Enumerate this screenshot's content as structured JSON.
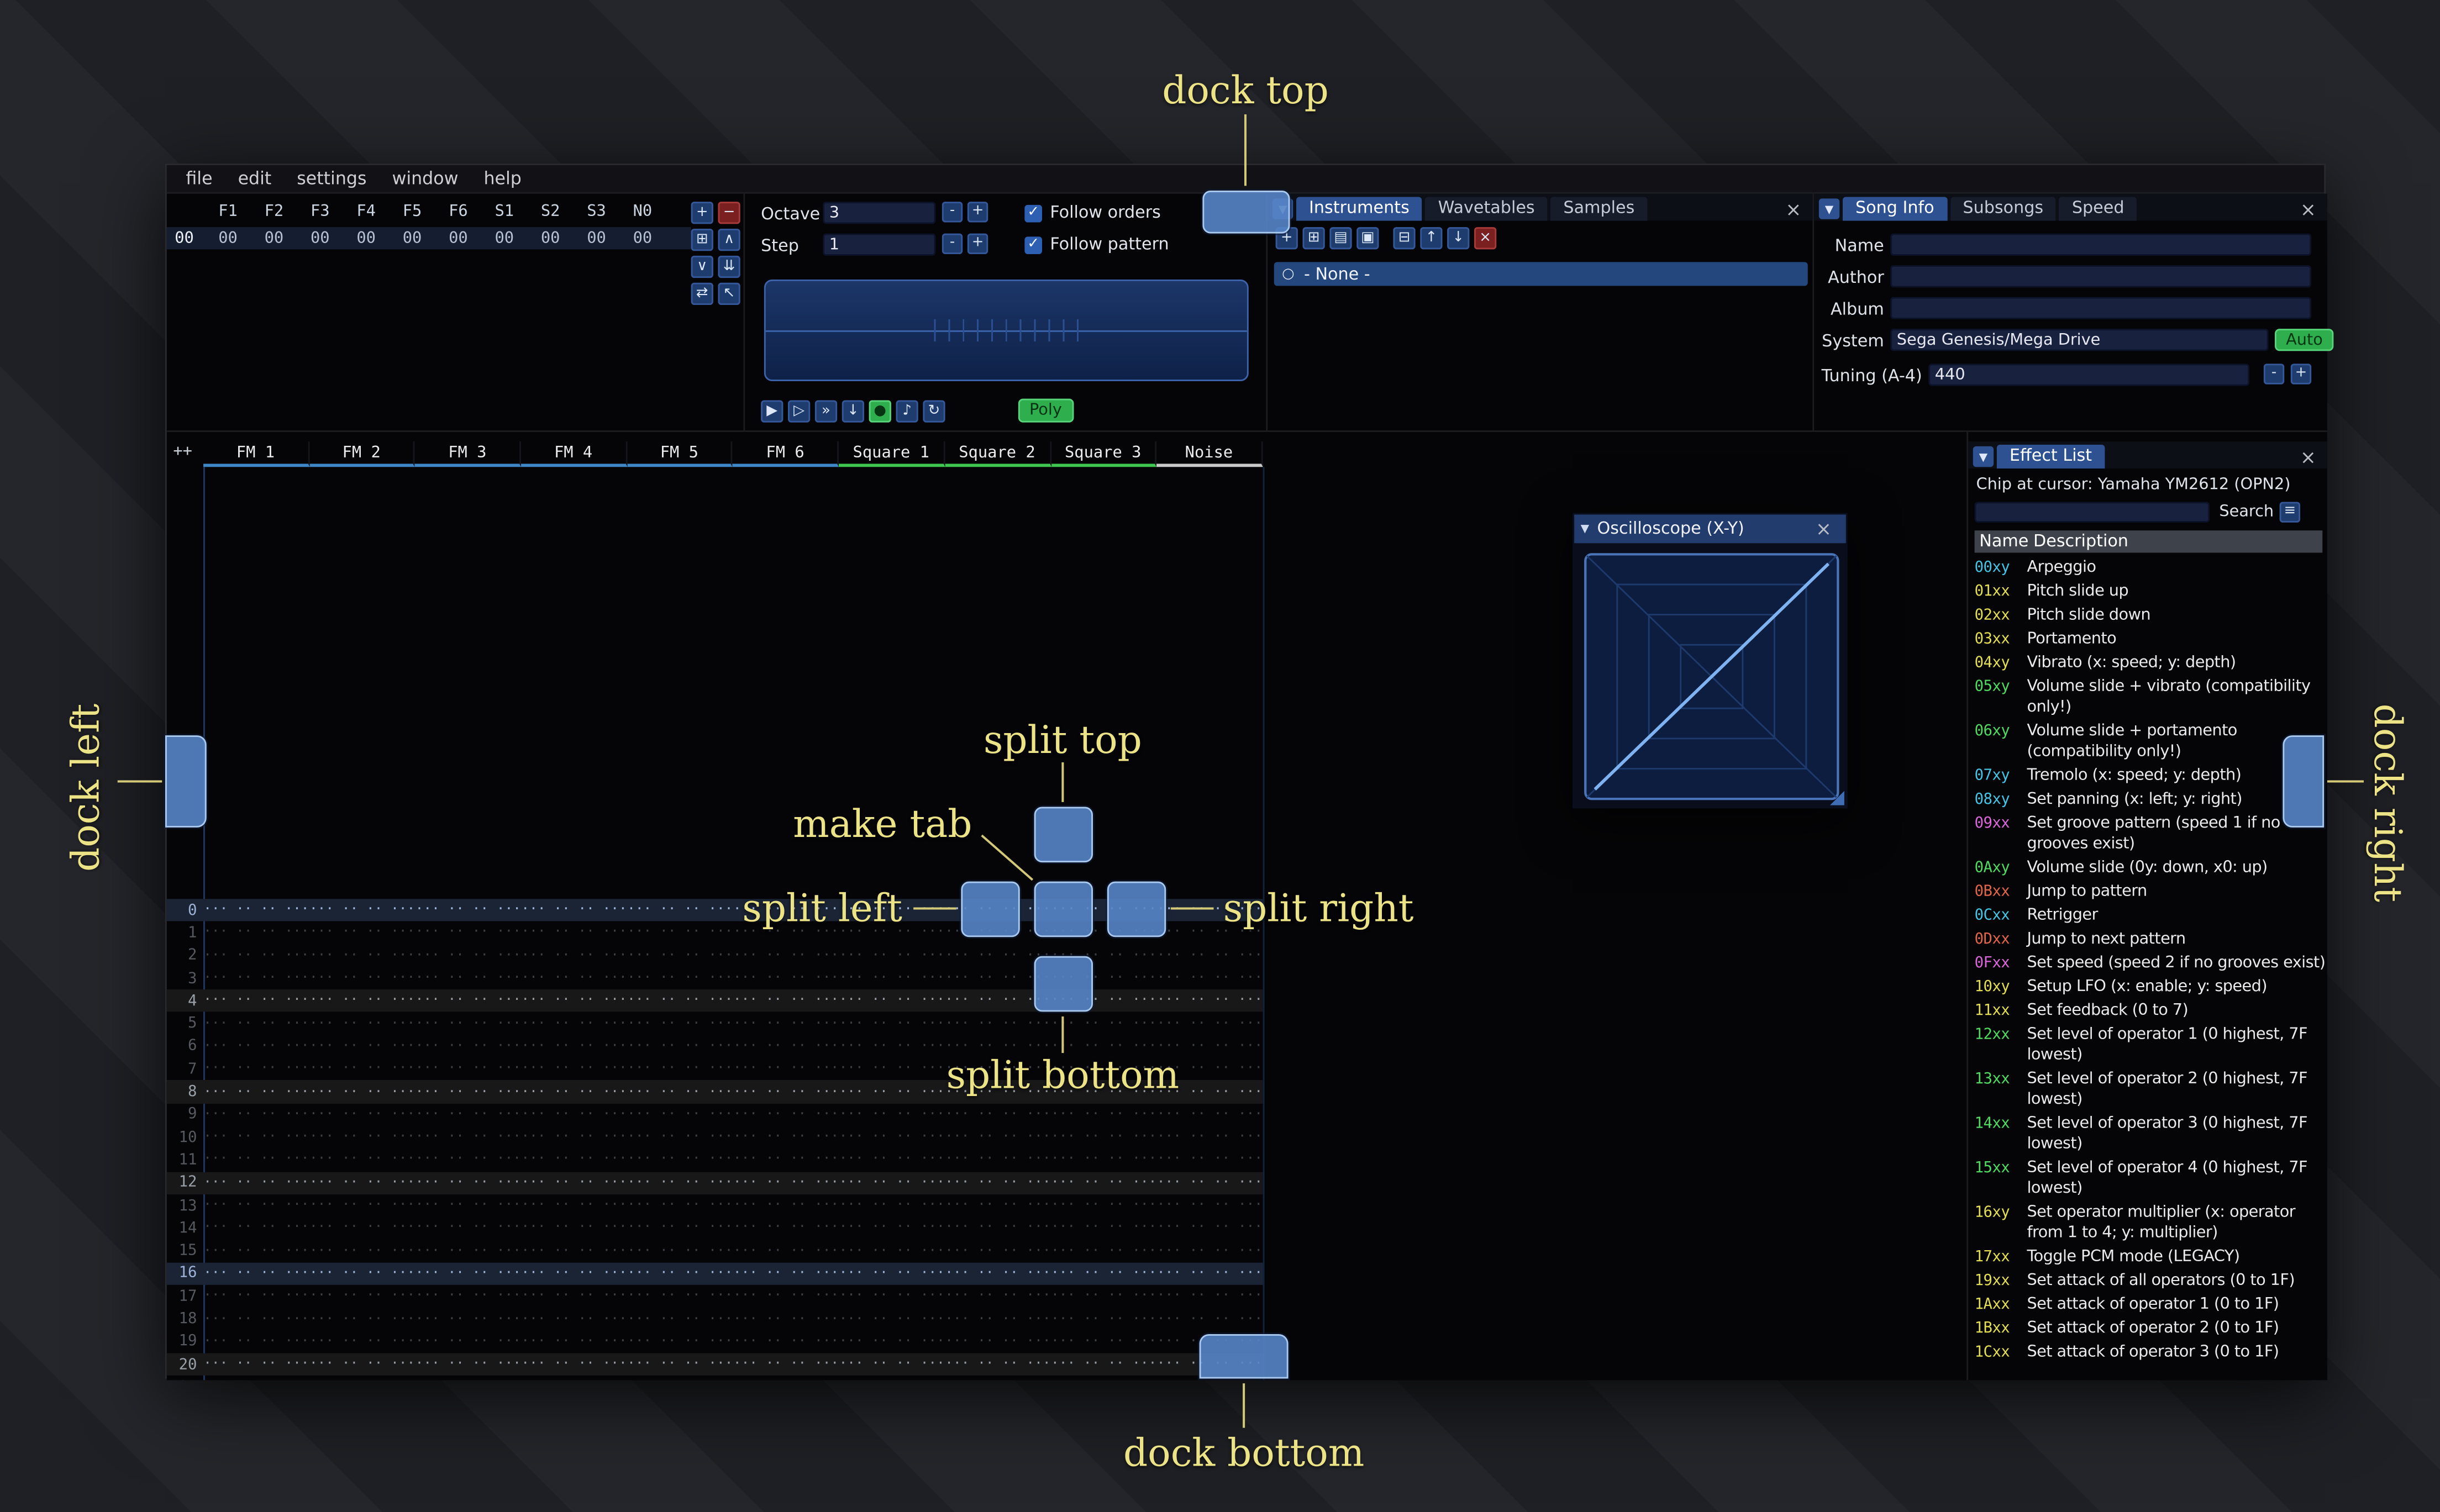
{
  "annotations": {
    "color": "#ece387",
    "dock_top": "dock top",
    "dock_bottom": "dock bottom",
    "dock_left": "dock left",
    "dock_right": "dock right",
    "split_top": "split top",
    "split_bottom": "split bottom",
    "split_left": "split left",
    "split_right": "split right",
    "make_tab": "make tab"
  },
  "menu": {
    "items": [
      "file",
      "edit",
      "settings",
      "window",
      "help"
    ]
  },
  "orders": {
    "columns": [
      "F1",
      "F2",
      "F3",
      "F4",
      "F5",
      "F6",
      "S1",
      "S2",
      "S3",
      "N0"
    ],
    "row": {
      "index": "00",
      "values": [
        "00",
        "00",
        "00",
        "00",
        "00",
        "00",
        "00",
        "00",
        "00",
        "00"
      ]
    },
    "buttons": [
      {
        "name": "add-order",
        "glyph": "+"
      },
      {
        "name": "remove-order",
        "glyph": "−",
        "kind": "red"
      },
      {
        "name": "duplicate-order",
        "glyph": "⊞"
      },
      {
        "name": "move-order-up",
        "glyph": "∧"
      },
      {
        "name": "move-order-down",
        "glyph": "∨"
      },
      {
        "name": "duplicate-order-to-end",
        "glyph": "⇊"
      },
      {
        "name": "order-change-mode",
        "glyph": "⇄"
      },
      {
        "name": "order-edit-mode",
        "glyph": "↖"
      }
    ]
  },
  "controls": {
    "octave_label": "Octave",
    "octave_value": "3",
    "step_label": "Step",
    "step_value": "1",
    "minus": "-",
    "plus": "+",
    "follow_orders": "Follow orders",
    "follow_pattern": "Follow pattern",
    "check_glyph": "✓",
    "poly_label": "Poly",
    "transport": [
      {
        "name": "play",
        "glyph": "▶"
      },
      {
        "name": "play-pattern",
        "glyph": "▷"
      },
      {
        "name": "play-one-row",
        "glyph": "»"
      },
      {
        "name": "step-one-row",
        "glyph": "↓"
      },
      {
        "name": "record",
        "glyph": "●",
        "kind": "green"
      },
      {
        "name": "metronome",
        "glyph": "♪"
      },
      {
        "name": "repeat-pattern",
        "glyph": "↻"
      }
    ]
  },
  "instruments": {
    "tabs": [
      "Instruments",
      "Wavetables",
      "Samples"
    ],
    "active_tab": 0,
    "toolbar": [
      {
        "name": "add-instrument",
        "glyph": "+"
      },
      {
        "name": "duplicate-instrument",
        "glyph": "⊞"
      },
      {
        "name": "open-instrument",
        "glyph": "▤"
      },
      {
        "name": "save-instrument",
        "glyph": "▣"
      },
      {
        "name": "toggle-folders",
        "glyph": "⊟"
      },
      {
        "name": "move-instrument-up",
        "glyph": "↑"
      },
      {
        "name": "move-instrument-down",
        "glyph": "↓"
      },
      {
        "name": "delete-instrument",
        "glyph": "×",
        "kind": "red"
      }
    ],
    "none_item": "- None -",
    "radio_glyph": "○"
  },
  "song_info": {
    "tabs": [
      "Song Info",
      "Subsongs",
      "Speed"
    ],
    "active_tab": 0,
    "name_label": "Name",
    "name_value": "",
    "author_label": "Author",
    "author_value": "",
    "album_label": "Album",
    "album_value": "",
    "system_label": "System",
    "system_value": "Sega Genesis/Mega Drive",
    "auto_label": "Auto",
    "tuning_label": "Tuning (A-4)",
    "tuning_value": "440"
  },
  "pattern": {
    "corner": "++",
    "row_count": 22,
    "empty_cell": "··· ·· ·· ···",
    "channels": [
      {
        "name": "FM 1",
        "color": "#3f86c7"
      },
      {
        "name": "FM 2",
        "color": "#3f86c7"
      },
      {
        "name": "FM 3",
        "color": "#3f86c7"
      },
      {
        "name": "FM 4",
        "color": "#3f86c7"
      },
      {
        "name": "FM 5",
        "color": "#3f86c7"
      },
      {
        "name": "FM 6",
        "color": "#3f86c7"
      },
      {
        "name": "Square 1",
        "color": "#3fc74f"
      },
      {
        "name": "Square 2",
        "color": "#3fc74f"
      },
      {
        "name": "Square 3",
        "color": "#3fc74f"
      },
      {
        "name": "Noise",
        "color": "#c9c9c9"
      }
    ]
  },
  "oscilloscope": {
    "title": "Oscilloscope (X-Y)"
  },
  "effect_list": {
    "title": "Effect List",
    "chip_line": "Chip at cursor: Yamaha YM2612 (OPN2)",
    "search_label": "Search",
    "search_value": "",
    "name_header": "Name",
    "desc_header": "Description",
    "effect_colors": {
      "cyan": "#45c5e6",
      "yellow": "#e3de52",
      "green": "#4fdb5f",
      "magenta": "#da66da",
      "red": "#e2654a"
    },
    "effects": [
      {
        "code": "00xy",
        "desc": "Arpeggio",
        "type": "cyan"
      },
      {
        "code": "01xx",
        "desc": "Pitch slide up",
        "type": "yellow"
      },
      {
        "code": "02xx",
        "desc": "Pitch slide down",
        "type": "yellow"
      },
      {
        "code": "03xx",
        "desc": "Portamento",
        "type": "yellow"
      },
      {
        "code": "04xy",
        "desc": "Vibrato (x: speed; y: depth)",
        "type": "yellow"
      },
      {
        "code": "05xy",
        "desc": "Volume slide + vibrato (compatibility only!)",
        "type": "green"
      },
      {
        "code": "06xy",
        "desc": "Volume slide + portamento (compatibility only!)",
        "type": "green"
      },
      {
        "code": "07xy",
        "desc": "Tremolo (x: speed; y: depth)",
        "type": "cyan"
      },
      {
        "code": "08xy",
        "desc": "Set panning (x: left; y: right)",
        "type": "cyan"
      },
      {
        "code": "09xx",
        "desc": "Set groove pattern (speed 1 if no grooves exist)",
        "type": "magenta"
      },
      {
        "code": "0Axy",
        "desc": "Volume slide (0y: down, x0: up)",
        "type": "green"
      },
      {
        "code": "0Bxx",
        "desc": "Jump to pattern",
        "type": "red"
      },
      {
        "code": "0Cxx",
        "desc": "Retrigger",
        "type": "cyan"
      },
      {
        "code": "0Dxx",
        "desc": "Jump to next pattern",
        "type": "red"
      },
      {
        "code": "0Fxx",
        "desc": "Set speed (speed 2 if no grooves exist)",
        "type": "magenta"
      },
      {
        "code": "10xy",
        "desc": "Setup LFO (x: enable; y: speed)",
        "type": "yellow"
      },
      {
        "code": "11xx",
        "desc": "Set feedback (0 to 7)",
        "type": "yellow"
      },
      {
        "code": "12xx",
        "desc": "Set level of operator 1 (0 highest, 7F lowest)",
        "type": "green"
      },
      {
        "code": "13xx",
        "desc": "Set level of operator 2 (0 highest, 7F lowest)",
        "type": "green"
      },
      {
        "code": "14xx",
        "desc": "Set level of operator 3 (0 highest, 7F lowest)",
        "type": "green"
      },
      {
        "code": "15xx",
        "desc": "Set level of operator 4 (0 highest, 7F lowest)",
        "type": "green"
      },
      {
        "code": "16xy",
        "desc": "Set operator multiplier (x: operator from 1 to 4; y: multiplier)",
        "type": "yellow"
      },
      {
        "code": "17xx",
        "desc": "Toggle PCM mode (LEGACY)",
        "type": "yellow"
      },
      {
        "code": "19xx",
        "desc": "Set attack of all operators (0 to 1F)",
        "type": "yellow"
      },
      {
        "code": "1Axx",
        "desc": "Set attack of operator 1 (0 to 1F)",
        "type": "yellow"
      },
      {
        "code": "1Bxx",
        "desc": "Set attack of operator 2 (0 to 1F)",
        "type": "yellow"
      },
      {
        "code": "1Cxx",
        "desc": "Set attack of operator 3 (0 to 1F)",
        "type": "yellow"
      }
    ]
  }
}
